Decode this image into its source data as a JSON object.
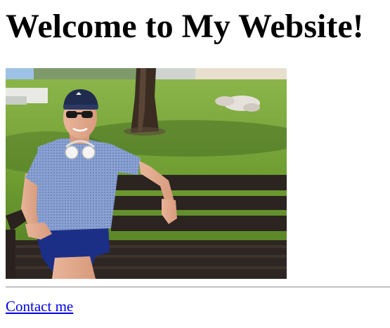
{
  "page": {
    "heading": "Welcome to My Website!",
    "contact_link": "Contact me"
  },
  "photo": {
    "subject": "man in cap and sunglasses with headphones around neck sitting on a park bench",
    "colors": {
      "grass": "#6a9a2e",
      "shirt": "#7f98cc",
      "shorts": "#1b2f86",
      "bench": "#2b2420",
      "cap": "#1f2c4f",
      "sky": "#d8dde0"
    }
  },
  "link_color": "#0000ee"
}
